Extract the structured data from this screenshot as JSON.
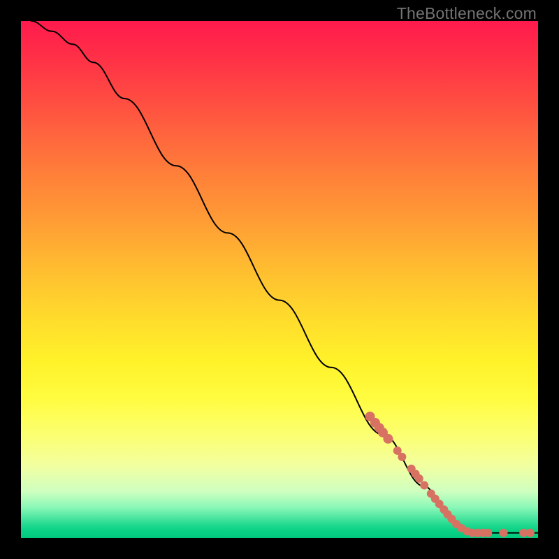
{
  "attribution": "TheBottleneck.com",
  "colors": {
    "marker": "#d77262",
    "curve": "#000000",
    "frame_bg": "#000000"
  },
  "chart_data": {
    "type": "line",
    "title": "",
    "xlabel": "",
    "ylabel": "",
    "xlim": [
      0,
      100
    ],
    "ylim": [
      0,
      100
    ],
    "grid": false,
    "legend": false,
    "series": [
      {
        "name": "curve",
        "type": "line",
        "points": [
          {
            "x": 2,
            "y": 100
          },
          {
            "x": 6,
            "y": 98
          },
          {
            "x": 10,
            "y": 95.5
          },
          {
            "x": 14,
            "y": 92
          },
          {
            "x": 20,
            "y": 85
          },
          {
            "x": 30,
            "y": 72
          },
          {
            "x": 40,
            "y": 59
          },
          {
            "x": 50,
            "y": 46
          },
          {
            "x": 60,
            "y": 33
          },
          {
            "x": 70,
            "y": 20
          },
          {
            "x": 78,
            "y": 10
          },
          {
            "x": 83,
            "y": 4
          },
          {
            "x": 86,
            "y": 1.5
          },
          {
            "x": 88,
            "y": 1
          },
          {
            "x": 100,
            "y": 1
          }
        ]
      },
      {
        "name": "markers",
        "type": "scatter",
        "points": [
          {
            "x": 67.5,
            "y": 23.5,
            "r": 7
          },
          {
            "x": 68.5,
            "y": 22.3,
            "r": 7
          },
          {
            "x": 69.3,
            "y": 21.3,
            "r": 7
          },
          {
            "x": 70.0,
            "y": 20.4,
            "r": 7
          },
          {
            "x": 71.0,
            "y": 19.2,
            "r": 7
          },
          {
            "x": 72.8,
            "y": 16.9,
            "r": 6
          },
          {
            "x": 73.7,
            "y": 15.7,
            "r": 6
          },
          {
            "x": 75.5,
            "y": 13.4,
            "r": 6
          },
          {
            "x": 76.3,
            "y": 12.4,
            "r": 6
          },
          {
            "x": 77.0,
            "y": 11.5,
            "r": 6
          },
          {
            "x": 78.0,
            "y": 10.2,
            "r": 6
          },
          {
            "x": 79.3,
            "y": 8.6,
            "r": 6
          },
          {
            "x": 80.1,
            "y": 7.6,
            "r": 6
          },
          {
            "x": 80.9,
            "y": 6.6,
            "r": 6
          },
          {
            "x": 81.8,
            "y": 5.5,
            "r": 6
          },
          {
            "x": 82.5,
            "y": 4.6,
            "r": 6
          },
          {
            "x": 83.3,
            "y": 3.7,
            "r": 6
          },
          {
            "x": 84.2,
            "y": 2.7,
            "r": 6
          },
          {
            "x": 85.2,
            "y": 1.9,
            "r": 6
          },
          {
            "x": 86.3,
            "y": 1.3,
            "r": 6
          },
          {
            "x": 87.3,
            "y": 1.0,
            "r": 6
          },
          {
            "x": 88.3,
            "y": 1.0,
            "r": 6
          },
          {
            "x": 89.3,
            "y": 1.0,
            "r": 6
          },
          {
            "x": 90.3,
            "y": 1.0,
            "r": 6
          },
          {
            "x": 93.3,
            "y": 1.0,
            "r": 6
          },
          {
            "x": 97.2,
            "y": 1.0,
            "r": 6
          },
          {
            "x": 98.5,
            "y": 1.0,
            "r": 6
          }
        ]
      }
    ]
  }
}
